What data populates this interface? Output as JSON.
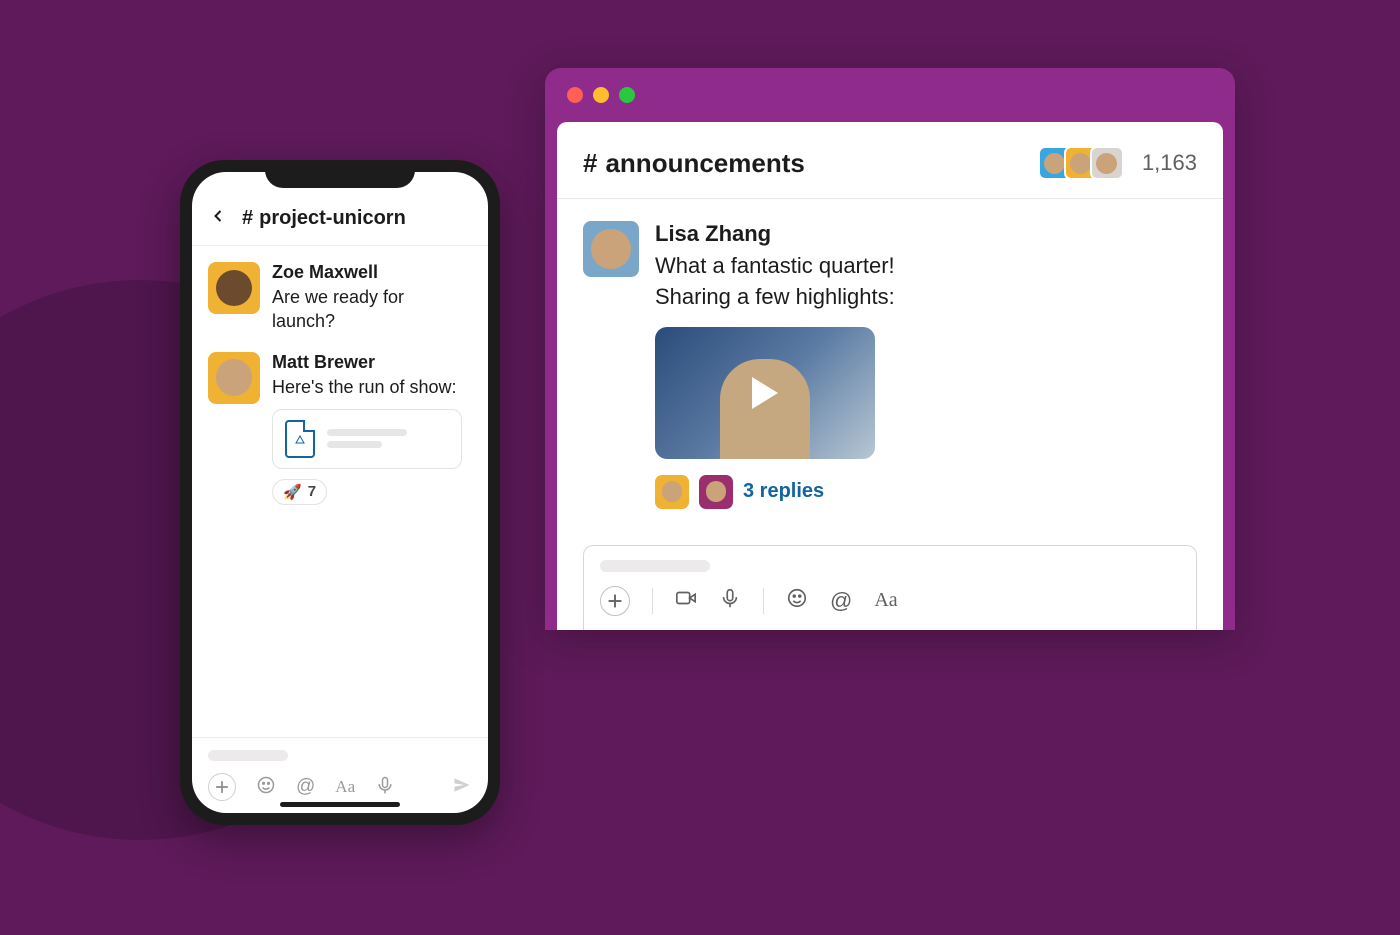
{
  "colors": {
    "bg": "#5e1a5a",
    "accent": "#8e2b8b",
    "link": "#1264a3"
  },
  "desktop": {
    "channel_prefix": "#",
    "channel_name": "announcements",
    "member_count": "1,163",
    "message": {
      "author": "Lisa Zhang",
      "line1": "What a fantastic quarter!",
      "line2": "Sharing a few highlights:",
      "replies_label": "3 replies"
    },
    "header_avatars": [
      {
        "bg": "#3aa6e0"
      },
      {
        "bg": "#f0b232"
      },
      {
        "bg": "#d9d4cf"
      }
    ],
    "reply_avatars": [
      {
        "bg": "#f0b232"
      },
      {
        "bg": "#9b2f6d"
      }
    ],
    "composer_icons": [
      "plus",
      "video",
      "microphone",
      "divider",
      "emoji",
      "mention",
      "text-format"
    ]
  },
  "mobile": {
    "channel_prefix": "#",
    "channel_name": "project-unicorn",
    "messages": [
      {
        "author": "Zoe Maxwell",
        "text": "Are we ready for launch?",
        "avatar_bg": "#f0b232"
      },
      {
        "author": "Matt Brewer",
        "text": "Here's the run of show:",
        "avatar_bg": "#f0b232",
        "attachment": {
          "type": "google-doc"
        },
        "reaction": {
          "emoji": "🚀",
          "count": "7"
        }
      }
    ],
    "composer_icons": [
      "plus",
      "emoji",
      "mention",
      "text-format",
      "microphone",
      "send"
    ]
  }
}
